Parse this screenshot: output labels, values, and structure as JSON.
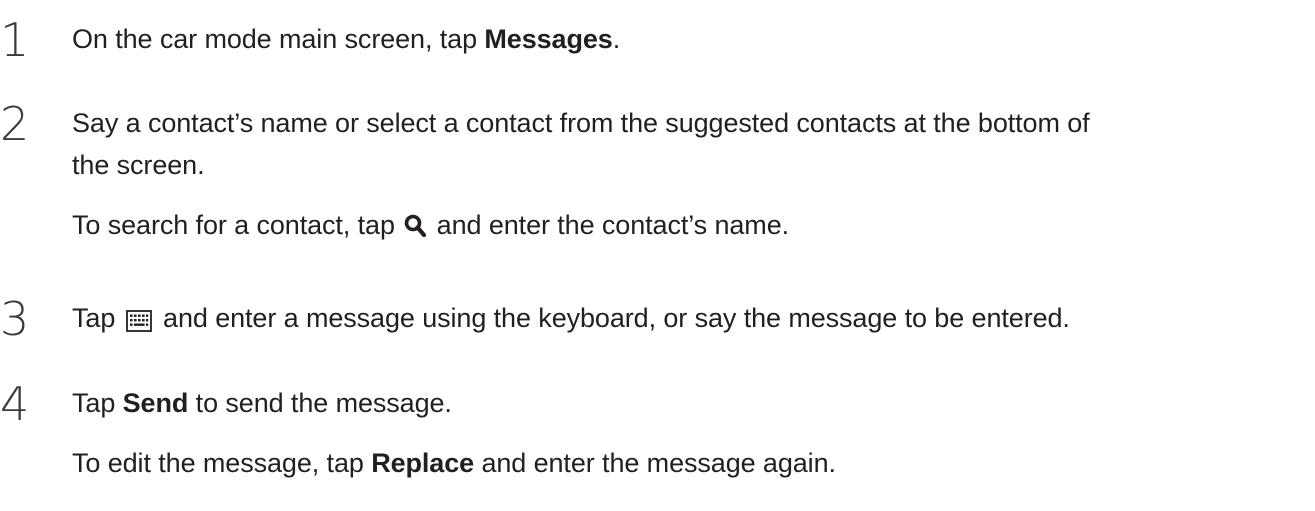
{
  "steps": [
    {
      "number": "1",
      "lines": [
        {
          "before": "On the car mode main screen, tap ",
          "bold": "Messages",
          "after": "."
        }
      ]
    },
    {
      "number": "2",
      "lines": [
        {
          "text": "Say a contact’s name or select a contact from the suggested contacts at the bottom of"
        },
        {
          "text": "the screen."
        },
        {
          "before": "To search for a contact, tap ",
          "icon": "search-icon",
          "after": " and enter the contact’s name."
        }
      ]
    },
    {
      "number": "3",
      "lines": [
        {
          "before": "Tap ",
          "icon": "keyboard-icon",
          "after": " and enter a message using the keyboard, or say the message to be entered."
        }
      ]
    },
    {
      "number": "4",
      "lines": [
        {
          "before": "Tap ",
          "bold": "Send",
          "after": " to send the message."
        },
        {
          "before": "To edit the message, tap ",
          "bold": "Replace",
          "after": " and enter the message again."
        }
      ]
    }
  ],
  "colors": {
    "text": "#231f20",
    "number": "#3a3a3a"
  }
}
